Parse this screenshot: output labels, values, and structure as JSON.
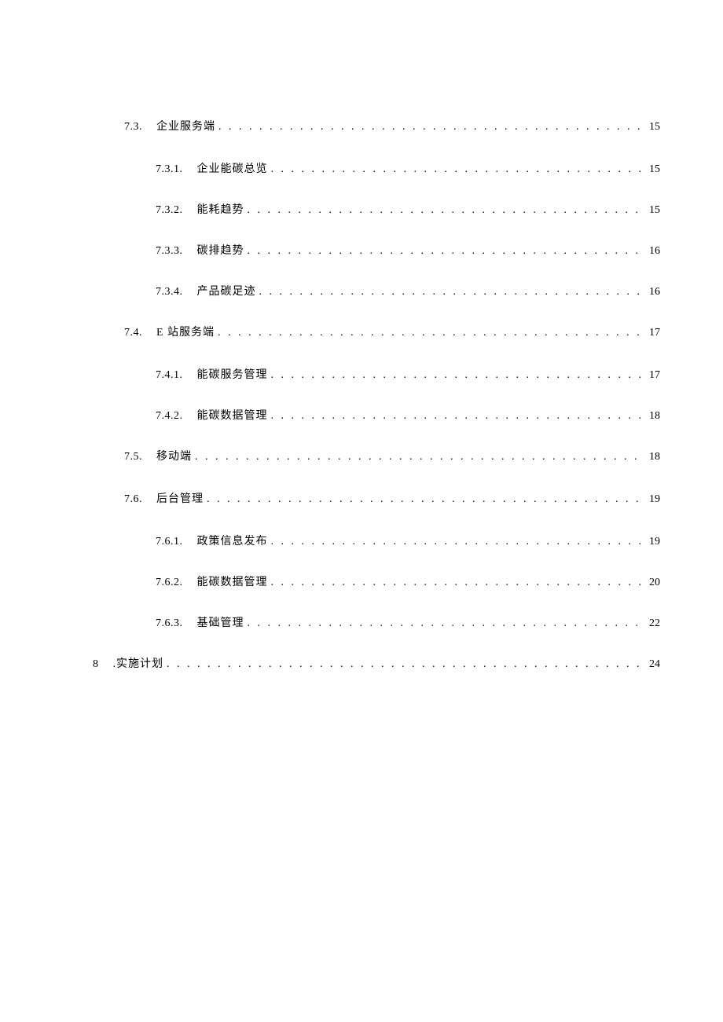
{
  "toc": [
    {
      "level": 2,
      "number": "7.3.",
      "title": "企业服务端",
      "page": "15"
    },
    {
      "level": 3,
      "number": "7.3.1.",
      "title": "企业能碳总览",
      "page": "15"
    },
    {
      "level": 3,
      "number": "7.3.2.",
      "title": "能耗趋势",
      "page": "15"
    },
    {
      "level": 3,
      "number": "7.3.3.",
      "title": "碳排趋势",
      "page": "16"
    },
    {
      "level": 3,
      "number": "7.3.4.",
      "title": "产品碳足迹",
      "page": "16"
    },
    {
      "level": 2,
      "number": "7.4.",
      "title": "E 站服务端",
      "page": "17"
    },
    {
      "level": 3,
      "number": "7.4.1.",
      "title": "能碳服务管理",
      "page": "17"
    },
    {
      "level": 3,
      "number": "7.4.2.",
      "title": "能碳数据管理",
      "page": "18"
    },
    {
      "level": 2,
      "number": "7.5.",
      "title": "移动端",
      "page": "18"
    },
    {
      "level": 2,
      "number": "7.6.",
      "title": "后台管理",
      "page": "19"
    },
    {
      "level": 3,
      "number": "7.6.1.",
      "title": "政策信息发布",
      "page": "19"
    },
    {
      "level": 3,
      "number": "7.6.2.",
      "title": "能碳数据管理",
      "page": "20"
    },
    {
      "level": 3,
      "number": "7.6.3.",
      "title": "基础管理",
      "page": "22"
    },
    {
      "level": 1,
      "number": "8",
      "title": ".实施计划",
      "page": "24"
    }
  ]
}
